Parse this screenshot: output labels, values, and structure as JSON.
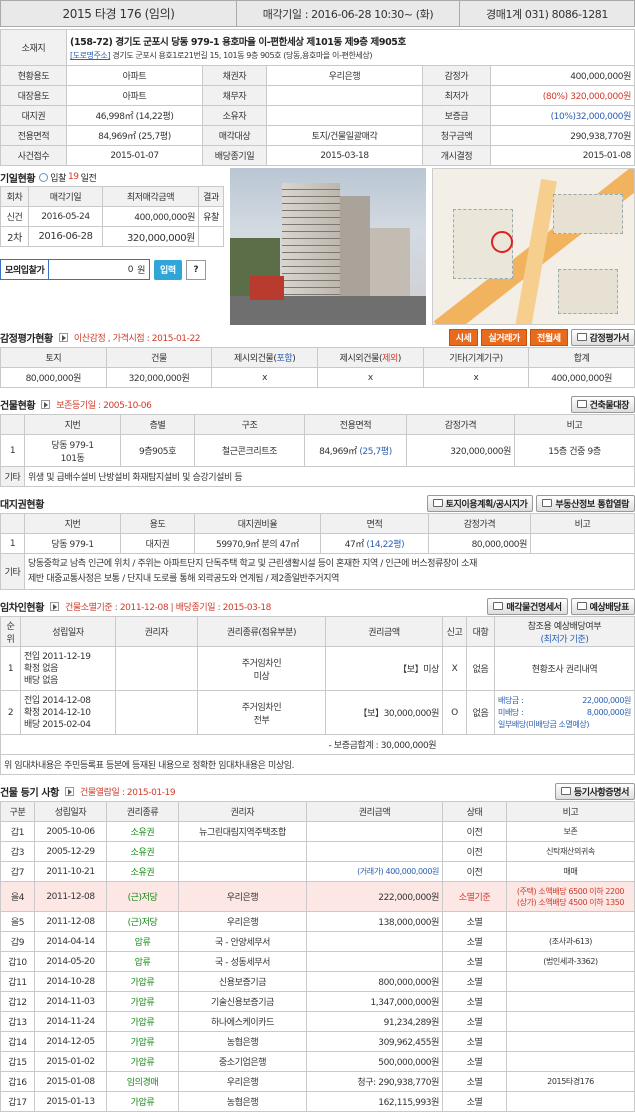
{
  "header": {
    "case": "2015 타경 176 (임의)",
    "date": "매각기일 : 2016-06-28 10:30~ (화)",
    "dept": "경매1계 031) 8086-1281"
  },
  "addr": {
    "label": "소재지",
    "main": "(158-72) 경기도 군포시 당동 979-1 용호마을 이-편한세상 제101동 제9층 제905호",
    "road_tag": "[도로명주소]",
    "road": "경기도 군포시 용호1로21번길 15, 101동 9층 905호 (당동,용호마을 이-편한세상)"
  },
  "info": [
    [
      "현황용도",
      "아파트",
      "채권자",
      "우리은행",
      "감정가",
      "400,000,000원"
    ],
    [
      "대장용도",
      "아파트",
      "채무자",
      "",
      "최저가",
      "(80%) 320,000,000원"
    ],
    [
      "대지권",
      "46,998㎡ (14,22평)",
      "소유자",
      "",
      "보증금",
      "(10%)32,000,000원"
    ],
    [
      "전용면적",
      "84,969㎡ (25,7평)",
      "매각대상",
      "토지/건물일괄매각",
      "청구금액",
      "290,938,770원"
    ],
    [
      "사건접수",
      "2015-01-07",
      "배당종기일",
      "2015-03-18",
      "개시결정",
      "2015-01-08"
    ]
  ],
  "auction": {
    "title": "기일현황",
    "bid_label": "입찰",
    "bid_days": "19",
    "bid_suffix": "일전",
    "cols": [
      "회차",
      "매각기일",
      "최저매각금액",
      "결과"
    ],
    "rows": [
      [
        "신건",
        "2016-05-24",
        "400,000,000원",
        "유찰"
      ],
      [
        "2차",
        "2016-06-28",
        "320,000,000원",
        ""
      ]
    ],
    "mock_label": "모의입찰가",
    "mock_value": "0",
    "mock_unit": "원",
    "input_btn": "입력",
    "help": "?"
  },
  "appraisal": {
    "title": "감정평가현황",
    "note": "이산감정 , 가격시점 : 2015-01-22",
    "btns": [
      "시세",
      "실거래가",
      "전월세"
    ],
    "detail_btn": "감정평가서",
    "cols": [
      "토지",
      "건물",
      "제시외건물(포함)",
      "제시외건물(제외)",
      "기타(기계기구)",
      "합계"
    ],
    "col3a": "제시외건물(",
    "col3b": "포함",
    "col4b": "제외",
    "row": [
      "80,000,000원",
      "320,000,000원",
      "x",
      "x",
      "x",
      "400,000,000원"
    ]
  },
  "building": {
    "title": "건물현황",
    "note": "보존등기일 : 2005-10-06",
    "btn": "건축물대장",
    "cols": [
      "",
      "지번",
      "층별",
      "구조",
      "전용면적",
      "감정가격",
      "비고"
    ],
    "row": [
      "1",
      "당동 979-1",
      "101동",
      "9층905호",
      "철근콘크리트조",
      "84,969㎡",
      "(25,7평)",
      "320,000,000원",
      "15층 건중 9층"
    ],
    "etc_label": "기타",
    "etc": "위생 및 급배수설비 난방설비 화재탐지설비 및 승강기설비 등"
  },
  "land": {
    "title": "대지권현황",
    "btn1": "토지이용계획/공시지가",
    "btn2": "부동산정보 통합열람",
    "cols": [
      "",
      "지번",
      "용도",
      "대지권비율",
      "면적",
      "감정가격",
      "비고"
    ],
    "row": [
      "1",
      "당동 979-1",
      "대지권",
      "59970,9㎡ 분의 47㎡",
      "47㎡",
      "(14,22평)",
      "80,000,000원"
    ],
    "etc_label": "기타",
    "etc1": "당동중학교 남측 인근에 위치 / 주위는 아파트단지 단독주택 학교 및 근린생활시설 등이 혼재한 지역 / 인근에 버스정류장이 소재",
    "etc2": "제반 대중교통사정은 보통 / 단지내 도로를 통해 외곽공도와 연계됨 / 제2종일반주거지역"
  },
  "tenant": {
    "title": "임차인현황",
    "note": "건물소멸기준 : 2011-12-08 | 배당종기일 : 2015-03-18",
    "btn1": "매각물건명세서",
    "btn2": "예상배당표",
    "cols": [
      "순위",
      "성립일자",
      "권리자",
      "권리종류(점유부분)",
      "권리금액",
      "신고",
      "대항",
      "참조용 예상배당여부",
      "(최저가 기준)"
    ],
    "r1": {
      "no": "1",
      "d1": "전입 2011-12-19",
      "d2": "확정 없음",
      "d3": "배당 없음",
      "k1": "주거임차인",
      "k2": "미상",
      "amt": "【보】미상",
      "rep": "X",
      "def": "없음",
      "ref": "현황조사 권리내역"
    },
    "r2": {
      "no": "2",
      "d1": "전입 2014-12-08",
      "d2": "확정 2014-12-10",
      "d3": "배당 2015-02-04",
      "k1": "주거임차인",
      "k2": "전부",
      "amt": "【보】30,000,000원",
      "rep": "O",
      "def": "없음",
      "ref1a": "배당금 :",
      "ref1b": "22,000,000원",
      "ref2a": "미배당 :",
      "ref2b": "8,000,000원",
      "ref3": "일부배당(미배당금 소멸예상)"
    },
    "sum": "- 보증금합계 : 30,000,000원",
    "footer": "위 임대차내용은 주민등록표 등본에 등재된 내용으로 정확한 임대차내용은 미상임."
  },
  "registry": {
    "title": "건물 등기 사항",
    "note": "건물열람일 : 2015-01-19",
    "btn": "등기사항증명서",
    "cols": [
      "구분",
      "성립일자",
      "권리종류",
      "권리자",
      "권리금액",
      "상태",
      "비고"
    ],
    "rows": [
      [
        "갑1",
        "2005-10-06",
        "소유권",
        "뉴그린대림지역주택조합",
        "",
        "이전",
        "보존"
      ],
      [
        "갑3",
        "2005-12-29",
        "소유권",
        "",
        "",
        "이전",
        "신탁재산의귀속"
      ],
      [
        "갑7",
        "2011-10-21",
        "소유권",
        "",
        "(거래가) 400,000,000원",
        "이전",
        "매매"
      ],
      [
        "을4",
        "2011-12-08",
        "(근)저당",
        "우리은행",
        "222,000,000원",
        "소멸기준",
        "(주택) 소액배당 6500 이하 2200|(상가) 소액배당 4500 이하 1350"
      ],
      [
        "을5",
        "2011-12-08",
        "(근)저당",
        "우리은행",
        "138,000,000원",
        "소멸",
        ""
      ],
      [
        "갑9",
        "2014-04-14",
        "압류",
        "국 - 안양세무서",
        "",
        "소멸",
        "(조사과-613)"
      ],
      [
        "갑10",
        "2014-05-20",
        "압류",
        "국 - 성동세무서",
        "",
        "소멸",
        "(법인세과-3362)"
      ],
      [
        "갑11",
        "2014-10-28",
        "가압류",
        "신용보증기금",
        "800,000,000원",
        "소멸",
        ""
      ],
      [
        "갑12",
        "2014-11-03",
        "가압류",
        "기술신용보증기금",
        "1,347,000,000원",
        "소멸",
        ""
      ],
      [
        "갑13",
        "2014-11-24",
        "가압류",
        "하나에스케이카드",
        "91,234,289원",
        "소멸",
        ""
      ],
      [
        "갑14",
        "2014-12-05",
        "가압류",
        "농협은행",
        "309,962,455원",
        "소멸",
        ""
      ],
      [
        "갑15",
        "2015-01-02",
        "가압류",
        "중소기업은행",
        "500,000,000원",
        "소멸",
        ""
      ],
      [
        "갑16",
        "2015-01-08",
        "임의경매",
        "우리은행",
        "청구: 290,938,770원",
        "소멸",
        "2015타경176"
      ],
      [
        "갑17",
        "2015-01-13",
        "가압류",
        "농협은행",
        "162,115,993원",
        "소멸",
        ""
      ]
    ]
  }
}
